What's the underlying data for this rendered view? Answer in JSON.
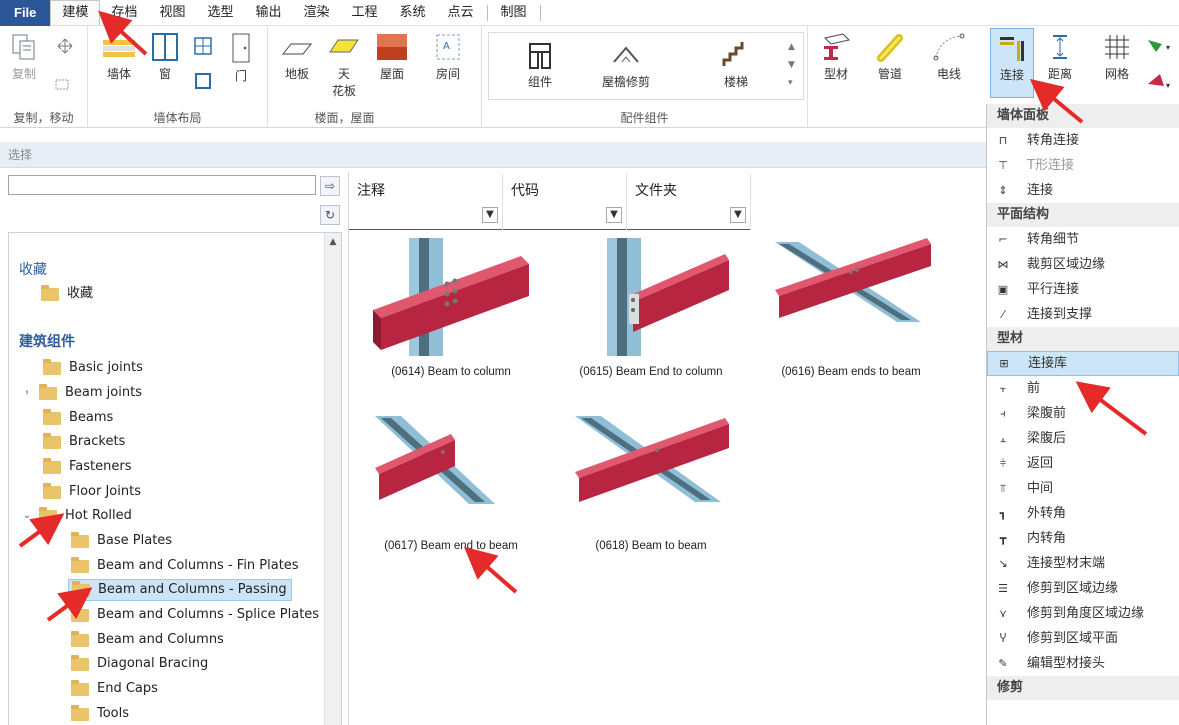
{
  "menu": {
    "file": "File",
    "tabs": [
      "建模",
      "存档",
      "视图",
      "选型",
      "输出",
      "渲染",
      "工程",
      "系统",
      "点云",
      "制图"
    ]
  },
  "ribbon": {
    "copy": "复制",
    "move_group": "复制，移动",
    "wall": "墙体",
    "window": "窗",
    "door": "门",
    "wall_layout": "墙体布局",
    "floor": "地板",
    "ceiling_a": "天",
    "ceiling_b": "花板",
    "roof": "屋面",
    "room": "房间",
    "floor_roof_group": "楼面，屋面",
    "component": "组件",
    "eave_trim": "屋檐修剪",
    "stairs": "楼梯",
    "component_group": "配件组件",
    "profile": "型材",
    "pipe": "管道",
    "wire": "电线",
    "connect": "连接",
    "distance": "距离",
    "grid": "网格"
  },
  "left_panel": {
    "header": "选择",
    "search_value": "",
    "sections": {
      "favorites": "收藏",
      "favorites_folder": "收藏",
      "building": "建筑组件"
    },
    "tree": [
      {
        "label": "Basic joints"
      },
      {
        "label": "Beam joints"
      },
      {
        "label": "Beams"
      },
      {
        "label": "Brackets"
      },
      {
        "label": "Fasteners"
      },
      {
        "label": "Floor Joints"
      },
      {
        "label": "Hot Rolled"
      },
      {
        "label": "Base Plates"
      },
      {
        "label": "Beam and Columns - Fin Plates"
      },
      {
        "label": "Beam and Columns - Passing"
      },
      {
        "label": "Beam and Columns - Splice Plates"
      },
      {
        "label": "Beam and Columns"
      },
      {
        "label": "Diagonal Bracing"
      },
      {
        "label": "End Caps"
      },
      {
        "label": "Tools"
      }
    ]
  },
  "content": {
    "columns": [
      "注释",
      "代码",
      "文件夹"
    ],
    "tiles": [
      {
        "caption": "(0614) Beam to column"
      },
      {
        "caption": "(0615) Beam End to column"
      },
      {
        "caption": "(0616) Beam ends to beam"
      },
      {
        "caption": "(0617) Beam end to beam"
      },
      {
        "caption": "(0618) Beam to beam"
      }
    ]
  },
  "dropdown": {
    "sections": [
      {
        "title": "墙体面板",
        "items": [
          {
            "label": "转角连接",
            "icon": "corner-connect-icon"
          },
          {
            "label": "T形连接",
            "icon": "t-connect-icon",
            "disabled": true
          },
          {
            "label": "连接",
            "icon": "connect-icon"
          }
        ]
      },
      {
        "title": "平面结构",
        "items": [
          {
            "label": "转角细节",
            "icon": "corner-detail-icon"
          },
          {
            "label": "裁剪区域边缘",
            "icon": "trim-edge-icon"
          },
          {
            "label": "平行连接",
            "icon": "parallel-connect-icon"
          },
          {
            "label": "连接到支撑",
            "icon": "connect-support-icon"
          }
        ]
      },
      {
        "title": "型材",
        "items": [
          {
            "label": "连接库",
            "icon": "connection-library-icon",
            "selected": true
          },
          {
            "label": "前",
            "icon": "front-icon"
          },
          {
            "label": "梁腹前",
            "icon": "web-front-icon"
          },
          {
            "label": "梁腹后",
            "icon": "web-back-icon"
          },
          {
            "label": "返回",
            "icon": "return-icon"
          },
          {
            "label": "中间",
            "icon": "middle-icon"
          },
          {
            "label": "外转角",
            "icon": "outer-corner-icon"
          },
          {
            "label": "内转角",
            "icon": "inner-corner-icon"
          },
          {
            "label": "连接型材末端",
            "icon": "connect-profile-end-icon"
          },
          {
            "label": "修剪到区域边缘",
            "icon": "trim-to-edge-icon"
          },
          {
            "label": "修剪到角度区域边缘",
            "icon": "trim-to-angle-edge-icon"
          },
          {
            "label": "修剪到区域平面",
            "icon": "trim-to-plane-icon"
          },
          {
            "label": "编辑型材接头",
            "icon": "edit-profile-joint-icon"
          }
        ]
      },
      {
        "title": "修剪",
        "items": []
      }
    ]
  },
  "colors": {
    "file_tab": "#2b579a",
    "beam_red": "#c42a43",
    "beam_blue": "#7fb7d4",
    "annotation_red": "#e52a2a",
    "selection": "#cce4f7"
  }
}
